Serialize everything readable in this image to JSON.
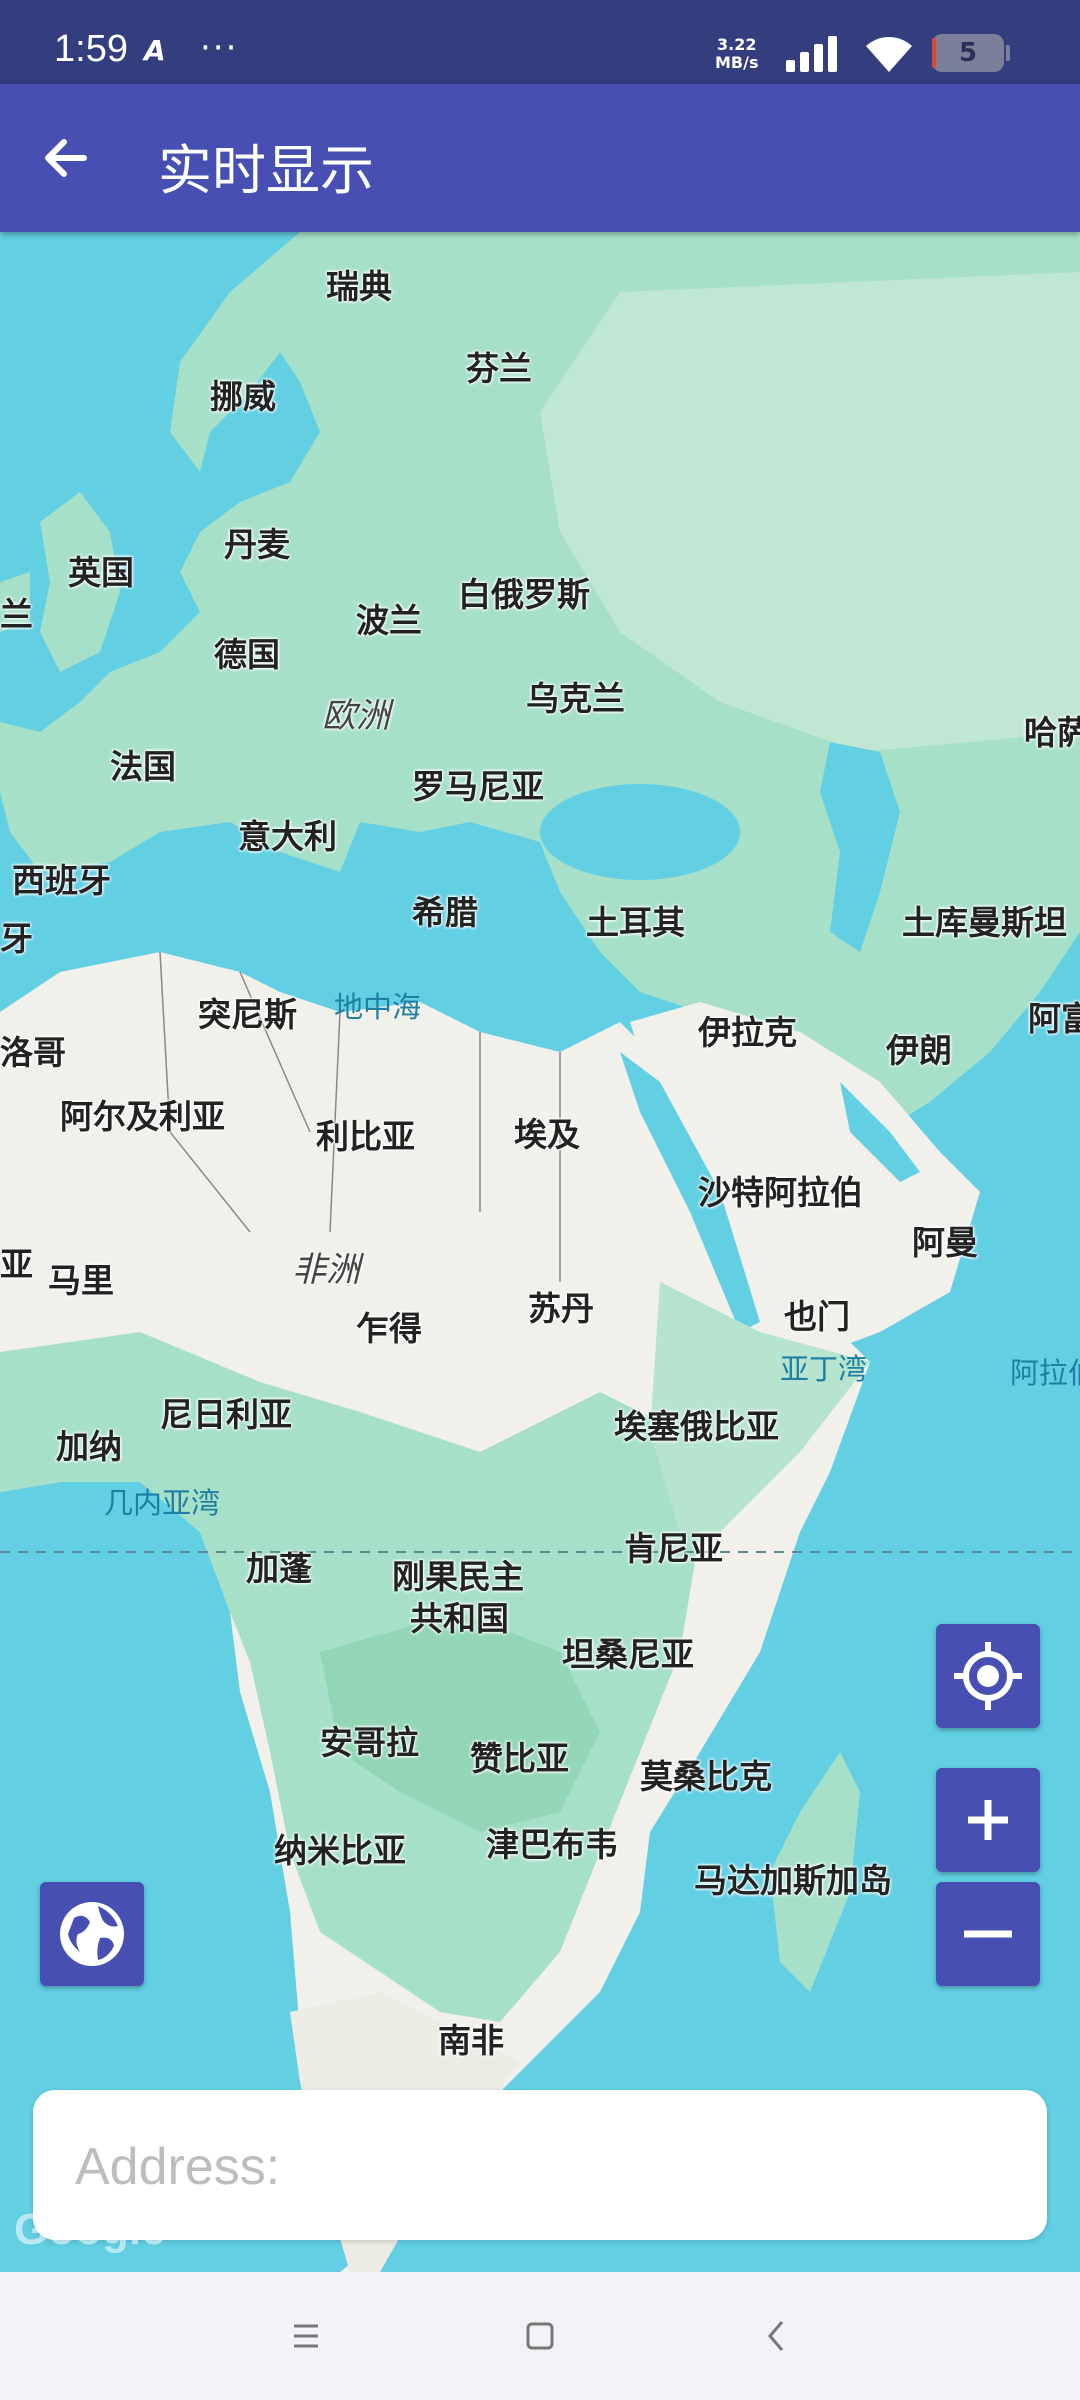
{
  "status_bar": {
    "time": "1:59",
    "app_icon_letter": "A",
    "more_dots": "···",
    "network_speed_value": "3.22",
    "network_speed_unit": "MB/s",
    "battery_level": "5",
    "icons": [
      "signal-icon",
      "wifi-icon",
      "battery-icon"
    ]
  },
  "app_bar": {
    "title": "实时显示",
    "back_icon": "arrow-left-icon",
    "background": "#4750b2"
  },
  "map": {
    "water_color": "#62cfe3",
    "land_color": "#a6e0c8",
    "countries": [
      "瑞典",
      "挪威",
      "芬兰",
      "丹麦",
      "英国",
      "兰",
      "波兰",
      "白俄罗斯",
      "德国",
      "乌克兰",
      "法国",
      "罗马尼亚",
      "意大利",
      "西班牙",
      "牙",
      "希腊",
      "土耳其",
      "土库曼斯坦",
      "哈萨",
      "突尼斯",
      "洛哥",
      "伊拉克",
      "伊朗",
      "阿富",
      "阿尔及利亚",
      "利比亚",
      "埃及",
      "沙特阿拉伯",
      "阿曼",
      "亚",
      "马里",
      "乍得",
      "苏丹",
      "也门",
      "尼日利亚",
      "埃塞俄比亚",
      "加纳",
      "加蓬",
      "刚果民主",
      "共和国",
      "肯尼亚",
      "坦桑尼亚",
      "安哥拉",
      "赞比亚",
      "莫桑比克",
      "纳米比亚",
      "津巴布韦",
      "马达加斯加岛",
      "南非"
    ],
    "continents": [
      "欧洲",
      "非洲"
    ],
    "seas": [
      "地中海",
      "亚丁湾",
      "阿拉伯",
      "几内亚湾"
    ],
    "attribution": "Google"
  },
  "controls": {
    "locate_icon": "crosshair-icon",
    "zoom_in_icon": "plus-icon",
    "zoom_out_icon": "minus-icon",
    "globe_icon": "globe-icon"
  },
  "address": {
    "placeholder": "Address:",
    "value": ""
  },
  "nav_bar": {
    "icons": [
      "menu-icon",
      "home-square-icon",
      "back-chevron-icon"
    ]
  }
}
